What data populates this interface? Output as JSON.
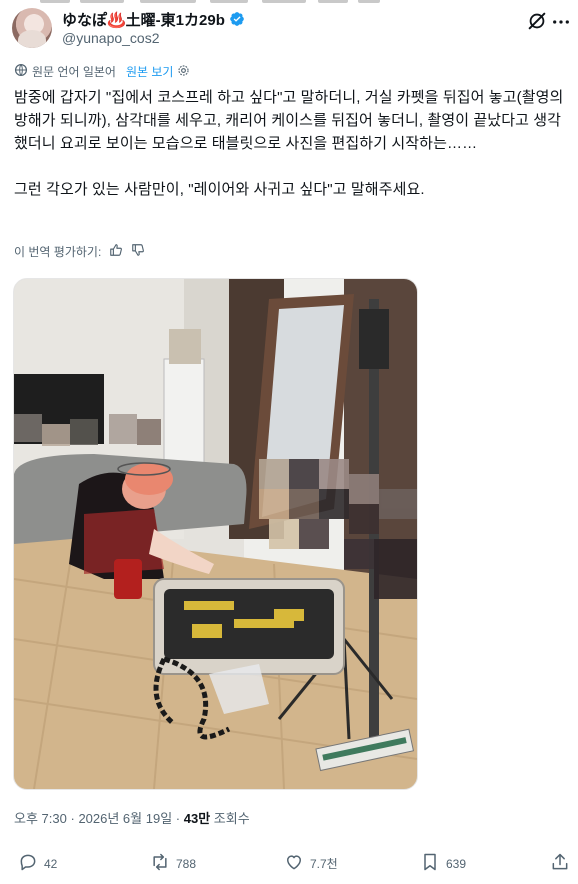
{
  "author": {
    "display_name": "ゆなぽ♨️土曜-東1カ29b",
    "handle": "@yunapo_cos2"
  },
  "translation": {
    "language_note": "원문 언어 일본어",
    "show_original": "원본 보기"
  },
  "tweet": {
    "paragraph1": "밤중에 갑자기 \"집에서 코스프레 하고 싶다\"고 말하더니, 거실 카펫을 뒤집어 놓고(촬영의 방해가 되니까), 삼각대를 세우고, 캐리어 케이스를 뒤집어 놓더니, 촬영이 끝났다고 생각했더니 요괴로 보이는 모습으로 태블릿으로 사진을 편집하기 시작하는……",
    "paragraph2": "그런 각오가 있는 사람만이, \"레이어와 사귀고 싶다\"고 말해주세요."
  },
  "rate_translation": "이 번역 평가하기:",
  "meta": {
    "time": "오후 7:30",
    "separator": "·",
    "date": "2026년 6월 19일",
    "views_count": "43만",
    "views_label": "조회수"
  },
  "actions": {
    "reply_count": "42",
    "retweet_count": "788",
    "like_count": "7.7천",
    "bookmark_count": "639"
  },
  "colors": {
    "accent": "#1d9bf0",
    "secondary_text": "#536471",
    "primary_text": "#0f1419"
  },
  "icons": [
    "verified-badge-icon",
    "grok-icon",
    "more-icon",
    "translate-icon",
    "gear-icon",
    "thumbs-up-icon",
    "thumbs-down-icon",
    "reply-icon",
    "retweet-icon",
    "like-icon",
    "bookmark-icon",
    "share-icon"
  ]
}
